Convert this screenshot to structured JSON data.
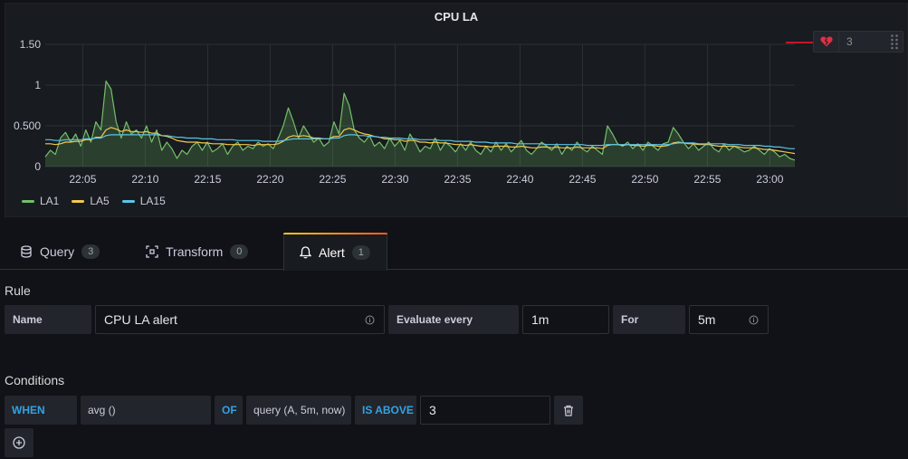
{
  "panel": {
    "title": "CPU LA",
    "threshold_value": "3"
  },
  "chart_data": {
    "type": "line",
    "title": "CPU LA",
    "ylim": [
      0,
      1.5
    ],
    "yticks": [
      "0",
      "0.500",
      "1",
      "1.50"
    ],
    "xticks": [
      "22:05",
      "22:10",
      "22:15",
      "22:20",
      "22:25",
      "22:30",
      "22:35",
      "22:40",
      "22:45",
      "22:50",
      "22:55",
      "23:00"
    ],
    "xlim": [
      "22:02",
      "23:02"
    ],
    "grid": true,
    "legend_position": "bottom-left",
    "series": [
      {
        "name": "LA1",
        "color": "#73bf69",
        "fill": true,
        "values": [
          0.12,
          0.2,
          0.15,
          0.35,
          0.42,
          0.3,
          0.4,
          0.25,
          0.45,
          0.3,
          0.55,
          0.45,
          1.05,
          0.95,
          0.55,
          0.35,
          0.55,
          0.4,
          0.45,
          0.35,
          0.5,
          0.3,
          0.45,
          0.2,
          0.3,
          0.22,
          0.1,
          0.2,
          0.15,
          0.25,
          0.3,
          0.2,
          0.3,
          0.18,
          0.22,
          0.28,
          0.15,
          0.25,
          0.3,
          0.2,
          0.25,
          0.22,
          0.3,
          0.25,
          0.28,
          0.22,
          0.35,
          0.5,
          0.72,
          0.55,
          0.35,
          0.5,
          0.4,
          0.3,
          0.35,
          0.25,
          0.3,
          0.55,
          0.4,
          0.9,
          0.75,
          0.45,
          0.35,
          0.3,
          0.38,
          0.25,
          0.3,
          0.22,
          0.35,
          0.25,
          0.32,
          0.2,
          0.4,
          0.3,
          0.18,
          0.25,
          0.22,
          0.35,
          0.2,
          0.3,
          0.25,
          0.18,
          0.28,
          0.2,
          0.3,
          0.2,
          0.15,
          0.25,
          0.18,
          0.3,
          0.2,
          0.28,
          0.18,
          0.25,
          0.32,
          0.2,
          0.15,
          0.22,
          0.3,
          0.25,
          0.2,
          0.28,
          0.15,
          0.25,
          0.2,
          0.3,
          0.22,
          0.18,
          0.25,
          0.2,
          0.15,
          0.5,
          0.4,
          0.28,
          0.25,
          0.3,
          0.22,
          0.28,
          0.2,
          0.3,
          0.25,
          0.2,
          0.28,
          0.3,
          0.48,
          0.4,
          0.3,
          0.22,
          0.28,
          0.2,
          0.25,
          0.3,
          0.22,
          0.18,
          0.28,
          0.2,
          0.25,
          0.22,
          0.18,
          0.2,
          0.25,
          0.2,
          0.15,
          0.22,
          0.18,
          0.12,
          0.15,
          0.1,
          0.08
        ]
      },
      {
        "name": "LA5",
        "color": "#f2c94c",
        "fill": false,
        "values": [
          0.28,
          0.28,
          0.27,
          0.28,
          0.3,
          0.3,
          0.31,
          0.31,
          0.33,
          0.33,
          0.36,
          0.36,
          0.45,
          0.48,
          0.46,
          0.43,
          0.45,
          0.43,
          0.43,
          0.42,
          0.43,
          0.41,
          0.41,
          0.38,
          0.37,
          0.35,
          0.32,
          0.31,
          0.3,
          0.3,
          0.3,
          0.29,
          0.29,
          0.28,
          0.28,
          0.28,
          0.27,
          0.27,
          0.27,
          0.27,
          0.27,
          0.26,
          0.27,
          0.27,
          0.27,
          0.27,
          0.28,
          0.31,
          0.36,
          0.38,
          0.37,
          0.38,
          0.37,
          0.35,
          0.35,
          0.34,
          0.34,
          0.37,
          0.37,
          0.45,
          0.47,
          0.45,
          0.42,
          0.4,
          0.39,
          0.37,
          0.36,
          0.34,
          0.34,
          0.33,
          0.33,
          0.31,
          0.32,
          0.32,
          0.3,
          0.3,
          0.29,
          0.3,
          0.29,
          0.29,
          0.28,
          0.27,
          0.27,
          0.26,
          0.27,
          0.26,
          0.25,
          0.25,
          0.24,
          0.25,
          0.25,
          0.25,
          0.24,
          0.24,
          0.25,
          0.24,
          0.23,
          0.23,
          0.24,
          0.24,
          0.23,
          0.24,
          0.23,
          0.23,
          0.23,
          0.24,
          0.23,
          0.23,
          0.23,
          0.23,
          0.22,
          0.26,
          0.27,
          0.27,
          0.26,
          0.27,
          0.26,
          0.26,
          0.25,
          0.26,
          0.26,
          0.25,
          0.25,
          0.26,
          0.29,
          0.3,
          0.29,
          0.28,
          0.28,
          0.27,
          0.27,
          0.27,
          0.26,
          0.25,
          0.25,
          0.25,
          0.25,
          0.24,
          0.23,
          0.23,
          0.23,
          0.22,
          0.21,
          0.21,
          0.2,
          0.19,
          0.18,
          0.17,
          0.16
        ]
      },
      {
        "name": "LA15",
        "color": "#5ac4e8",
        "fill": false,
        "values": [
          0.33,
          0.33,
          0.32,
          0.32,
          0.33,
          0.33,
          0.33,
          0.33,
          0.34,
          0.34,
          0.35,
          0.35,
          0.38,
          0.39,
          0.39,
          0.39,
          0.39,
          0.39,
          0.39,
          0.39,
          0.39,
          0.39,
          0.39,
          0.38,
          0.38,
          0.37,
          0.36,
          0.36,
          0.35,
          0.35,
          0.35,
          0.34,
          0.34,
          0.34,
          0.33,
          0.33,
          0.33,
          0.33,
          0.32,
          0.32,
          0.32,
          0.32,
          0.32,
          0.31,
          0.31,
          0.31,
          0.31,
          0.32,
          0.33,
          0.34,
          0.34,
          0.34,
          0.34,
          0.34,
          0.34,
          0.34,
          0.34,
          0.35,
          0.35,
          0.38,
          0.39,
          0.39,
          0.38,
          0.38,
          0.37,
          0.37,
          0.36,
          0.36,
          0.35,
          0.35,
          0.35,
          0.34,
          0.34,
          0.34,
          0.33,
          0.33,
          0.33,
          0.33,
          0.32,
          0.32,
          0.32,
          0.31,
          0.31,
          0.31,
          0.31,
          0.3,
          0.3,
          0.3,
          0.29,
          0.29,
          0.29,
          0.29,
          0.29,
          0.28,
          0.28,
          0.28,
          0.28,
          0.28,
          0.28,
          0.27,
          0.27,
          0.27,
          0.27,
          0.27,
          0.27,
          0.27,
          0.27,
          0.26,
          0.26,
          0.26,
          0.26,
          0.27,
          0.27,
          0.27,
          0.27,
          0.27,
          0.27,
          0.27,
          0.27,
          0.27,
          0.27,
          0.27,
          0.27,
          0.27,
          0.28,
          0.29,
          0.29,
          0.29,
          0.29,
          0.28,
          0.28,
          0.28,
          0.28,
          0.28,
          0.28,
          0.27,
          0.27,
          0.27,
          0.26,
          0.26,
          0.26,
          0.26,
          0.25,
          0.25,
          0.24,
          0.24,
          0.23,
          0.22,
          0.22
        ]
      }
    ]
  },
  "tabs": [
    {
      "label": "Query",
      "count": "3",
      "icon": "database-icon"
    },
    {
      "label": "Transform",
      "count": "0",
      "icon": "transform-icon"
    },
    {
      "label": "Alert",
      "count": "1",
      "icon": "bell-icon"
    }
  ],
  "rule": {
    "section_title": "Rule",
    "name_label": "Name",
    "name_value": "CPU LA alert",
    "evaluate_label": "Evaluate every",
    "evaluate_value": "1m",
    "for_label": "For",
    "for_value": "5m"
  },
  "conditions": {
    "section_title": "Conditions",
    "when": "WHEN",
    "reducer": "avg ()",
    "of": "OF",
    "query": "query (A, 5m, now)",
    "evaluator": "IS ABOVE",
    "threshold": "3"
  }
}
